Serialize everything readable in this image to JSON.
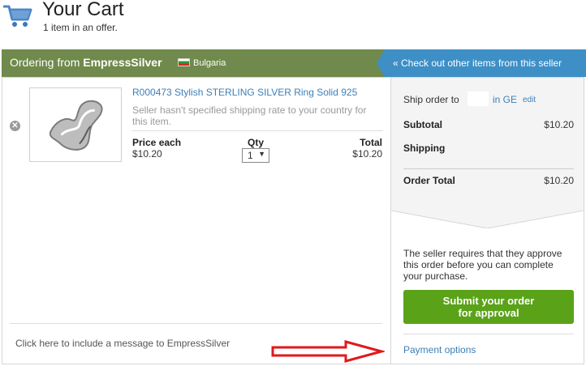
{
  "header": {
    "title": "Your Cart",
    "subtitle": "1 item in an offer."
  },
  "banner": {
    "prefix": "Ordering from ",
    "seller_name": "EmpressSilver",
    "country": "Bulgaria",
    "seller_link": "« Check out other items from this seller"
  },
  "item": {
    "title": "R000473 Stylish STERLING SILVER Ring Solid 925",
    "shipping_note": "Seller hasn't specified shipping rate to your country for this item.",
    "price_label": "Price each",
    "price": "$10.20",
    "qty_label": "Qty",
    "qty": "1",
    "total_label": "Total",
    "total": "$10.20"
  },
  "message_link": "Click here to include a message to EmpressSilver",
  "summary": {
    "ship_prefix": "Ship order to",
    "ship_country": "in GE",
    "edit": "edit",
    "subtotal_label": "Subtotal",
    "subtotal": "$10.20",
    "shipping_label": "Shipping",
    "order_total_label": "Order Total",
    "order_total": "$10.20"
  },
  "approval_note": "The seller requires that they approve this order before you can complete your purchase.",
  "submit": {
    "line1": "Submit your order",
    "line2": "for approval"
  },
  "payment_link": "Payment options",
  "colors": {
    "banner_green": "#6f8a4c",
    "link_blue": "#3d7fb6",
    "seller_bar_blue": "#3d8fc6",
    "submit_green": "#5aa218",
    "arrow_red": "#e0191d"
  },
  "icons": {
    "cart": "cart-icon",
    "remove": "remove-icon",
    "arrow": "red-arrow-annotation"
  }
}
